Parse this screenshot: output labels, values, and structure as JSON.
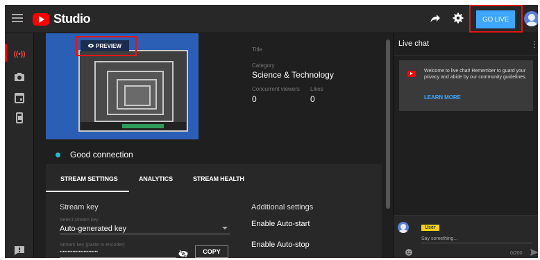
{
  "app": {
    "title": "Studio"
  },
  "header": {
    "go_live_label": "GO LIVE"
  },
  "preview": {
    "chip_label": "PREVIEW"
  },
  "stream_info": {
    "title_label": "Title",
    "category_label": "Category",
    "category_value": "Science & Technology",
    "viewers_label": "Concurrent viewers",
    "viewers_value": "0",
    "likes_label": "Likes",
    "likes_value": "0"
  },
  "connection": {
    "status": "Good connection",
    "color": "#2bb8c9"
  },
  "tabs": [
    {
      "label": "STREAM SETTINGS",
      "active": true
    },
    {
      "label": "ANALYTICS",
      "active": false
    },
    {
      "label": "STREAM HEALTH",
      "active": false
    }
  ],
  "stream_settings": {
    "stream_key_title": "Stream key",
    "select_label": "Select stream key",
    "select_value": "Auto-generated key",
    "key_label": "Stream key (paste in encoder)",
    "key_value": "••••••••••••••••••••••••",
    "copy_label": "COPY"
  },
  "additional": {
    "title": "Additional settings",
    "auto_start": "Enable Auto-start",
    "auto_stop": "Enable Auto-stop"
  },
  "chat": {
    "title": "Live chat",
    "welcome_text": "Welcome to live chat! Remember to guard your privacy and abide by our community guidelines.",
    "learn_more": "LEARN MORE",
    "user_badge": "User",
    "input_placeholder": "Say something...",
    "counter": "0/200"
  },
  "colors": {
    "accent": "#3ea6ff",
    "brand_red": "#ff0000",
    "highlight_box": "#e01818",
    "user_badge": "#f6d11b"
  },
  "icons": [
    "menu-icon",
    "youtube-logo-icon",
    "share-icon",
    "gear-icon",
    "avatar-icon",
    "live-icon",
    "camera-icon",
    "calendar-icon",
    "mobile-icon",
    "feedback-icon",
    "eye-icon",
    "emoji-icon",
    "send-icon",
    "more-vert-icon"
  ]
}
